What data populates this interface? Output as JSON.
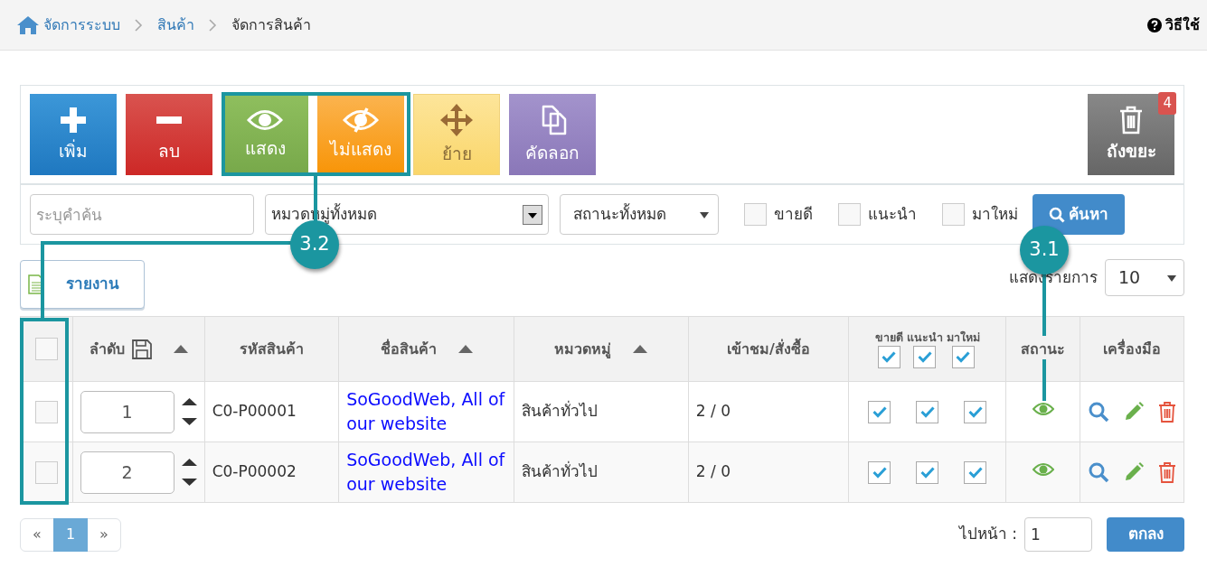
{
  "breadcrumb": [
    {
      "label": "จัดการระบบ",
      "kind": "home"
    },
    {
      "label": "สินค้า",
      "kind": "link"
    },
    {
      "label": "จัดการสินค้า",
      "kind": "current"
    }
  ],
  "help": "วิธีใช้",
  "toolbar": {
    "buttons": [
      {
        "label": "เพิ่ม",
        "kind": "add"
      },
      {
        "label": "ลบ",
        "kind": "remove"
      },
      {
        "label": "แสดง",
        "kind": "show"
      },
      {
        "label": "ไม่แสดง",
        "kind": "hide"
      },
      {
        "label": "ย้าย",
        "kind": "move"
      },
      {
        "label": "คัดลอก",
        "kind": "copy"
      }
    ],
    "trash": {
      "label": "ถังขยะ",
      "badge": "4"
    }
  },
  "filters": {
    "search_placeholder": "ระบุคำค้น",
    "category": "หมวดหมู่ทั้งหมด",
    "status": "สถานะทั้งหมด",
    "checkboxes": [
      {
        "label": "ขายดี",
        "checked": false
      },
      {
        "label": "แนะนำ",
        "checked": false
      },
      {
        "label": "มาใหม่",
        "checked": false
      }
    ],
    "search_button": "ค้นหา"
  },
  "report_button": "รายงาน",
  "page_size": {
    "label": "แสดงรายการ",
    "value": "10"
  },
  "table": {
    "select_all": {
      "selected": false
    },
    "columns": [
      {
        "label": "ลำดับ",
        "sortable": true
      },
      {
        "label": "รหัสสินค้า",
        "sortable": false
      },
      {
        "label": "ชื่อสินค้า",
        "sortable": true
      },
      {
        "label": "หมวดหมู่",
        "sortable": true
      },
      {
        "label": "เข้าชม/สั่งซื้อ",
        "sortable": false
      },
      {
        "label": "สถานะ",
        "sortable": false
      },
      {
        "label": "เครื่องมือ",
        "sortable": false
      }
    ],
    "flags": [
      {
        "label": "ขายดี",
        "checked": true
      },
      {
        "label": "แนะนำ",
        "checked": true
      },
      {
        "label": "มาใหม่",
        "checked": true
      }
    ],
    "rows": [
      {
        "selected": false,
        "order": "1",
        "code": "C0-P00001",
        "name": "SoGoodWeb, All of our website",
        "category": "สินค้าทั่วไป",
        "views": "2 / 0",
        "flags": [
          true,
          true,
          true
        ],
        "visible": true
      },
      {
        "selected": false,
        "order": "2",
        "code": "C0-P00002",
        "name": "SoGoodWeb, All of our website",
        "category": "สินค้าทั่วไป",
        "views": "2 / 0",
        "flags": [
          true,
          true,
          true
        ],
        "visible": true
      }
    ]
  },
  "pagination": [
    {
      "label": "«",
      "selected": false
    },
    {
      "label": "1",
      "selected": true
    },
    {
      "label": "»",
      "selected": false
    }
  ],
  "goto": {
    "label": "ไปหน้า :",
    "value": "1",
    "button": "ตกลง"
  },
  "annotations": [
    {
      "label": "3.2"
    },
    {
      "label": "3.1"
    }
  ]
}
